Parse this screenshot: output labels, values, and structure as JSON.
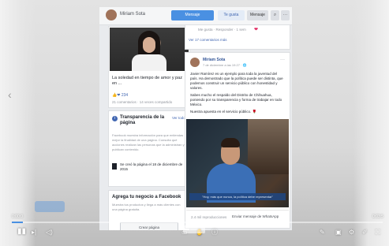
{
  "player": {
    "time_left": "0:00:0",
    "time_right": "0:03:5",
    "progress_fraction": 0.03,
    "accent": "#4a90e2",
    "controls_left": [
      "play-icon",
      "skip-forward-icon",
      "volume-icon"
    ],
    "controls_center": [
      "chat-icon",
      "hand-icon",
      "info-icon"
    ],
    "controls_right": [
      "pen-icon",
      "captions-icon",
      "settings-icon",
      "edit-icon",
      "fullscreen-icon"
    ]
  },
  "fb": {
    "page_name": "Miriam Sota",
    "buttons": {
      "message": "Mensaje",
      "like": "Te gusta",
      "message2": "Mensaje",
      "search": "⌕",
      "more": "···"
    },
    "left_post": {
      "caption": "La soledad en tiempo de amor y paz en ...",
      "reactions": "234",
      "meta": "21 comentarios · 14 veces compartido"
    },
    "transparency": {
      "title": "Transparencia de la página",
      "link": "Ver todo",
      "body": "Facebook muestra información para que entiendas mejor la finalidad de una página. Consulta qué acciones realizan las personas que la administran y publican contenido.",
      "created": "Se creó la página el 18 de diciembre de 2015"
    },
    "add_card": {
      "title": "Agrega tu negocio a Facebook",
      "body": "Muestra tus productos y llega a más clientes con una página gratuita.",
      "button": "Crear página"
    },
    "post_top": {
      "line": "Me gusta · Responder · 1 sem",
      "more": "Ver 17 comentarios más"
    },
    "post": {
      "author": "Miriam Sota",
      "time": "7 de diciembre a las 19:27 · 🌐",
      "dots": "···",
      "p1": "Javier Ramírez es un ejemplo para toda la juventud del país. Ha demostrado que la política puede ser distinta, que podemos construir un servicio público con honestidad y valores.",
      "p2": "Sabes mucho el respaldo del Distrito de Chihuahua, poniendo por su transparencia y forma de trabajar en todo México.",
      "p3": "Nuestra apuesta en el servicio público. 🌹",
      "video_caption": "\"Hoy, más que nunca, la política debe representar\"",
      "views": "2.4 mil reproducciones",
      "send": "Enviar mensaje de WhatsApp"
    }
  }
}
